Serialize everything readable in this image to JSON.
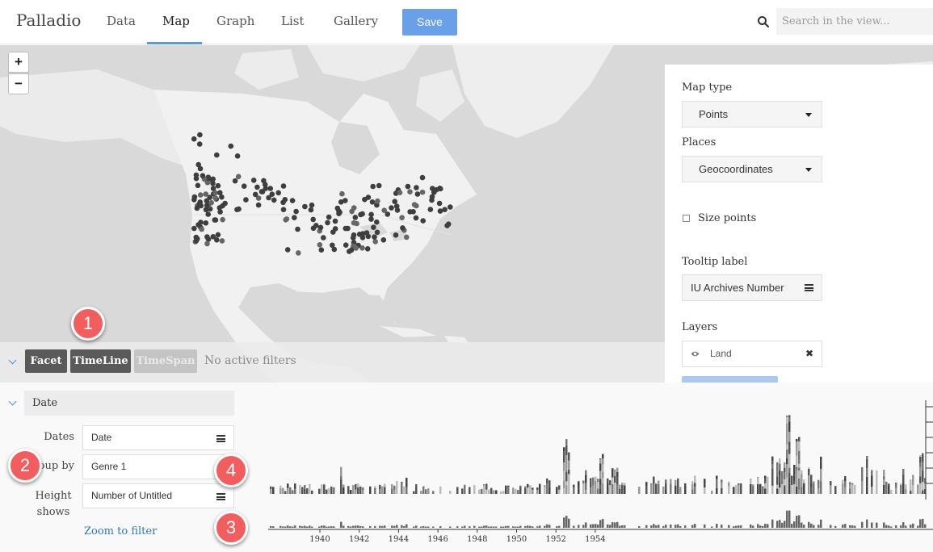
{
  "nav": {
    "brand": "Palladio",
    "items": [
      {
        "label": "Data",
        "active": false
      },
      {
        "label": "Map",
        "active": true
      },
      {
        "label": "Graph",
        "active": false
      },
      {
        "label": "List",
        "active": false
      },
      {
        "label": "Gallery",
        "active": false
      }
    ],
    "save_label": "Save",
    "search_placeholder": "Search in the view...",
    "search_icon": "search-icon",
    "accent_color": "#5b9bd5"
  },
  "map": {
    "zoom_in_label": "+",
    "zoom_out_label": "−"
  },
  "settings": {
    "map_type_label": "Map type",
    "map_type_value": "Points",
    "places_label": "Places",
    "places_value": "Geocoordinates",
    "size_points_label": "Size points",
    "size_points_checked": false,
    "tooltip_label": "Tooltip label",
    "tooltip_value": "IU Archives Number",
    "layers_label": "Layers",
    "layers": [
      {
        "name": "Land",
        "visible": true,
        "icon": "eye-icon",
        "remove_icon": "close-icon"
      }
    ]
  },
  "filters": {
    "buttons": [
      {
        "label": "Facet",
        "enabled": true
      },
      {
        "label": "TimeLine",
        "enabled": true
      },
      {
        "label": "TimeSpan",
        "enabled": false
      }
    ],
    "status": "No active filters"
  },
  "timeline": {
    "header": "Date",
    "dates_label": "Dates",
    "dates_value": "Date",
    "group_label": "oup by",
    "group_value": "Genre 1",
    "height_label": "Height shows",
    "height_value": "Number of Untitled",
    "zoom_link": "Zoom to filter",
    "year_ticks": [
      "1940",
      "1942",
      "1944",
      "1946",
      "1948",
      "1950",
      "1952",
      "1954"
    ]
  },
  "annotations": [
    "1",
    "2",
    "3",
    "4"
  ],
  "colors": {
    "annotation": "#f25d5d",
    "filter_button": "#5a5a5a",
    "link": "#2a7ab8"
  }
}
